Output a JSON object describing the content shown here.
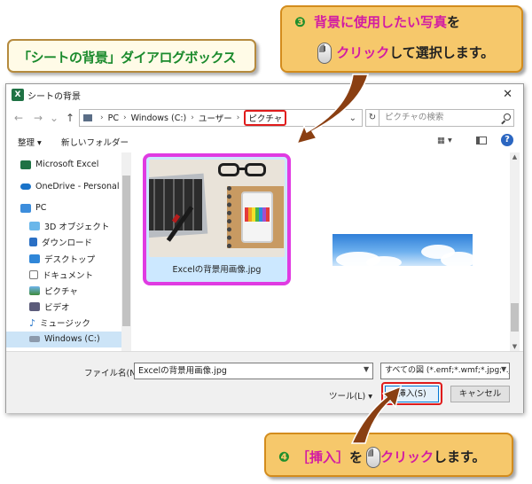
{
  "callouts": {
    "dialog_label": "「シートの背景」ダイアログボックス",
    "step3": {
      "num": "❸",
      "line1_emph": "背景に使用したい写真",
      "line1_tail": "を",
      "line2_emph": "クリック",
      "line2_tail": "して選択します。"
    },
    "step4": {
      "num": "❹",
      "emph": "［挿入］",
      "mid": "を",
      "emph2": "クリック",
      "tail": "します。"
    }
  },
  "dialog": {
    "title": "シートの背景",
    "app_icon": "X",
    "close_label": "✕",
    "nav": {
      "back": "←",
      "forward": "→",
      "down": "⌄",
      "up": "↑"
    },
    "breadcrumb": [
      "PC",
      "Windows (C:)",
      "ユーザー",
      "ピクチャ"
    ],
    "refresh": "↻",
    "search_placeholder": "ピクチャの検索",
    "toolbar": {
      "organize": "整理 ▾",
      "new_folder": "新しいフォルダー",
      "view": "▦ ▾",
      "help": "?"
    },
    "sidebar": [
      {
        "label": "Microsoft Excel",
        "icon": "excel-icon"
      },
      {
        "label": "OneDrive - Personal",
        "icon": "onedrive-icon"
      },
      {
        "label": "PC",
        "icon": "pc-icon"
      },
      {
        "label": "3D オブジェクト",
        "icon": "3d-objects-icon"
      },
      {
        "label": "ダウンロード",
        "icon": "download-icon"
      },
      {
        "label": "デスクトップ",
        "icon": "desktop-icon"
      },
      {
        "label": "ドキュメント",
        "icon": "document-icon"
      },
      {
        "label": "ピクチャ",
        "icon": "pictures-icon"
      },
      {
        "label": "ビデオ",
        "icon": "video-icon"
      },
      {
        "label": "ミュージック",
        "icon": "music-icon"
      },
      {
        "label": "Windows (C:)",
        "icon": "drive-icon"
      }
    ],
    "files": [
      {
        "name": "Excelの背景用画像.jpg",
        "selected": true
      },
      {
        "name": "",
        "selected": false
      }
    ],
    "bottom": {
      "filename_label": "ファイル名(N):",
      "filename_value": "Excelの背景用画像.jpg",
      "filetype_value": "すべての図 (*.emf;*.wmf;*.jpg;*.jp",
      "tools_label": "ツール(L) ▾",
      "insert_label": "挿入(S)",
      "cancel_label": "キャンセル"
    }
  },
  "colors": {
    "accent_red": "#e01b1b",
    "selection_magenta": "#e03be2",
    "callout_orange": "#f6c86b",
    "excel_green": "#1f7244"
  }
}
